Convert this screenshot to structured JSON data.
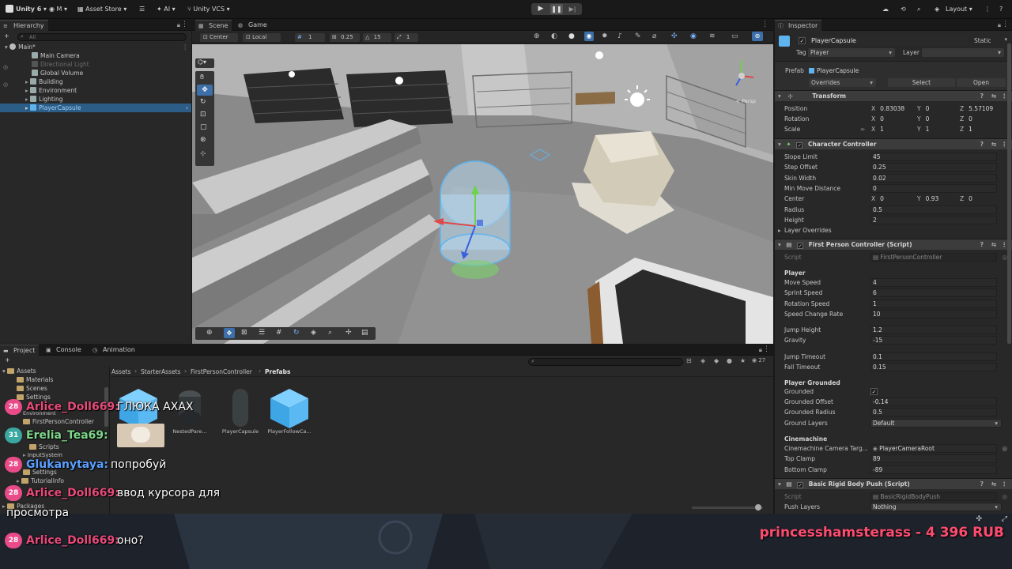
{
  "toolbar": {
    "unity_label": "Unity 6",
    "account_label": "M",
    "asset_store_label": "Asset Store",
    "ai_label": "AI",
    "vcs_label": "Unity VCS",
    "layout_label": "Layout"
  },
  "hierarchy": {
    "tab_label": "Hierarchy",
    "search_placeholder": "All",
    "scene_name": "Main*",
    "items": [
      {
        "label": "Main Camera"
      },
      {
        "label": "Directional Light"
      },
      {
        "label": "Global Volume"
      },
      {
        "label": "Building"
      },
      {
        "label": "Environment"
      },
      {
        "label": "Lighting"
      },
      {
        "label": "PlayerCapsule"
      }
    ]
  },
  "scene": {
    "scene_tab": "Scene",
    "game_tab": "Game",
    "pivot_label": "Center",
    "space_label": "Local",
    "grid_value": "1",
    "snap_value": "0.25",
    "angle_value": "15",
    "scale_value": "1",
    "persp_label": "< Persp"
  },
  "inspector": {
    "tab_label": "Inspector",
    "object_name": "PlayerCapsule",
    "static_label": "Static",
    "tag_label": "Tag",
    "tag_value": "Player",
    "layer_label": "Layer",
    "prefab_label": "Prefab",
    "prefab_value": "PlayerCapsule",
    "overrides_label": "Overrides",
    "select_label": "Select",
    "open_label": "Open",
    "transform": {
      "title": "Transform",
      "position_label": "Position",
      "position": [
        "0.83038",
        "0",
        "5.57109"
      ],
      "rotation_label": "Rotation",
      "rotation": [
        "0",
        "0",
        "0"
      ],
      "scale_label": "Scale",
      "scale": [
        "1",
        "1",
        "1"
      ]
    },
    "character_controller": {
      "title": "Character Controller",
      "rows": [
        {
          "label": "Slope Limit",
          "value": "45"
        },
        {
          "label": "Step Offset",
          "value": "0.25"
        },
        {
          "label": "Skin Width",
          "value": "0.02"
        },
        {
          "label": "Min Move Distance",
          "value": "0"
        }
      ],
      "center_label": "Center",
      "center": [
        "0",
        "0.93",
        "0"
      ],
      "radius_label": "Radius",
      "radius": "0.5",
      "height_label": "Height",
      "height": "2",
      "layer_overrides_label": "Layer Overrides"
    },
    "fpc": {
      "title": "First Person Controller (Script)",
      "script_label": "Script",
      "script_value": "FirstPersonController",
      "player_section": "Player",
      "rows1": [
        {
          "label": "Move Speed",
          "value": "4"
        },
        {
          "label": "Sprint Speed",
          "value": "6"
        },
        {
          "label": "Rotation Speed",
          "value": "1"
        },
        {
          "label": "Speed Change Rate",
          "value": "10"
        }
      ],
      "rows2": [
        {
          "label": "Jump Height",
          "value": "1.2"
        },
        {
          "label": "Gravity",
          "value": "-15"
        }
      ],
      "rows3": [
        {
          "label": "Jump Timeout",
          "value": "0.1"
        },
        {
          "label": "Fall Timeout",
          "value": "0.15"
        }
      ],
      "grounded_section": "Player Grounded",
      "grounded_label": "Grounded",
      "rows4": [
        {
          "label": "Grounded Offset",
          "value": "-0.14"
        },
        {
          "label": "Grounded Radius",
          "value": "0.5"
        }
      ],
      "ground_layers_label": "Ground Layers",
      "ground_layers_value": "Default",
      "cinemachine_section": "Cinemachine",
      "cam_target_label": "Cinemachine Camera Targ...",
      "cam_target_value": "PlayerCameraRoot",
      "top_clamp_label": "Top Clamp",
      "top_clamp_value": "89",
      "bottom_clamp_label": "Bottom Clamp",
      "bottom_clamp_value": "-89"
    },
    "brbp": {
      "title": "Basic Rigid Body Push (Script)",
      "script_label": "Script",
      "script_value": "BasicRigidBodyPush",
      "push_layers_label": "Push Layers",
      "push_layers_value": "Nothing"
    }
  },
  "project": {
    "project_tab": "Project",
    "console_tab": "Console",
    "animation_tab": "Animation",
    "breadcrumb": [
      "Assets",
      "StarterAssets",
      "FirstPersonController",
      "Prefabs"
    ],
    "hidden_count": "27",
    "tree": [
      {
        "label": "Assets"
      },
      {
        "label": "Materials"
      },
      {
        "label": "Scenes"
      },
      {
        "label": "Settings"
      },
      {
        "label": "Environment"
      },
      {
        "label": "FirstPersonController"
      },
      {
        "label": "Scripts"
      },
      {
        "label": "InputSystem"
      },
      {
        "label": "Settings"
      },
      {
        "label": "TutorialInfo"
      },
      {
        "label": "Packages"
      }
    ],
    "assets": [
      {
        "label": ""
      },
      {
        "label": "NestedPare..."
      },
      {
        "label": "PlayerCapsule"
      },
      {
        "label": "PlayerFollowCa..."
      }
    ]
  },
  "chat": [
    {
      "badge": "28",
      "name": "Arlice_Doll669:",
      "name_color": "#e84a7a",
      "message": "ГЛЮКА АХАХ"
    },
    {
      "badge": "31",
      "name": "Erelia_Tea69:",
      "name_color": "#7dd88a",
      "message": ""
    },
    {
      "badge": "28",
      "name": "Glukanytaya:",
      "name_color": "#5aa0ff",
      "message": "попробуй"
    },
    {
      "badge": "28",
      "name": "Arlice_Doll669:",
      "name_color": "#e84a7a",
      "message": "ввод курсора для"
    },
    {
      "badge": "",
      "name": "",
      "name_color": "#ffffff",
      "message": "просмотра"
    },
    {
      "badge": "28",
      "name": "Arlice_Doll669:",
      "name_color": "#e84a7a",
      "message": "оно?"
    }
  ],
  "donation": {
    "text": "princesshamsterass - 4 396 RUB",
    "color": "#ff4b6e"
  },
  "colors": {
    "accent": "#2c5d87",
    "prefab_blue": "#5fb4f0"
  }
}
